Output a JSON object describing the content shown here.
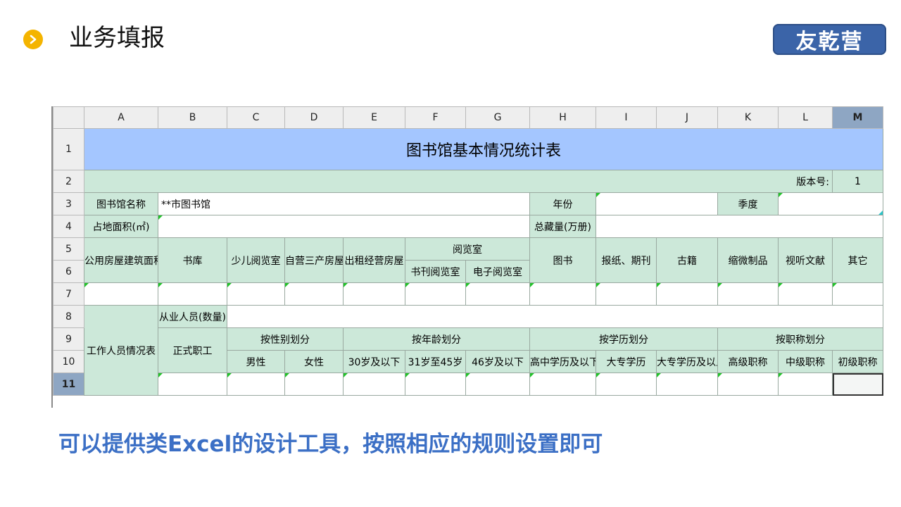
{
  "page": {
    "title": "业务填报",
    "logo_text": "友乾营",
    "caption": "可以提供类Excel的设计工具，按照相应的规则设置即可",
    "colors": {
      "bullet": "#f4b400",
      "logo_bg": "#3b64a8",
      "caption": "#3b6fc5",
      "title_fill": "#a4c6ff",
      "label_fill": "#cce8d9"
    }
  },
  "sheet": {
    "columns": [
      "A",
      "B",
      "C",
      "D",
      "E",
      "F",
      "G",
      "H",
      "I",
      "J",
      "K",
      "L",
      "M"
    ],
    "rows": [
      "1",
      "2",
      "3",
      "4",
      "5",
      "6",
      "7",
      "8",
      "9",
      "10",
      "11"
    ],
    "title": "图书馆基本情况统计表",
    "version_label": "版本号:",
    "version_value": "1",
    "library_name_label": "图书馆名称",
    "library_name_value": "**市图书馆",
    "year_label": "年份",
    "quarter_label": "季度",
    "area_label": "占地面积(㎡)",
    "collection_label": "总藏量(万册)",
    "public_area": "公用房屋建筑面积",
    "stack_room": "书库",
    "children_room": "少儿阅览室",
    "self_run": "自营三产房屋",
    "rental": "出租经营房屋",
    "reading_room": "阅览室",
    "periodical_room": "书刊阅览室",
    "e_room": "电子阅览室",
    "books": "图书",
    "newspapers": "报纸、期刊",
    "ancient": "古籍",
    "microform": "缩微制品",
    "audiovisual": "视听文献",
    "other": "其它",
    "staff_table": "工作人员情况表",
    "employees_count": "从业人员(数量)",
    "formal_staff": "正式职工",
    "by_gender": "按性别划分",
    "by_age": "按年龄划分",
    "by_education": "按学历划分",
    "by_title": "按职称划分",
    "male": "男性",
    "female": "女性",
    "age1": "30岁及以下",
    "age2": "31岁至45岁",
    "age3": "46岁及以下",
    "edu1": "高中学历及以下",
    "edu2": "大专学历",
    "edu3": "大专学历及以上",
    "title1": "高级职称",
    "title2": "中级职称",
    "title3": "初级职称"
  }
}
